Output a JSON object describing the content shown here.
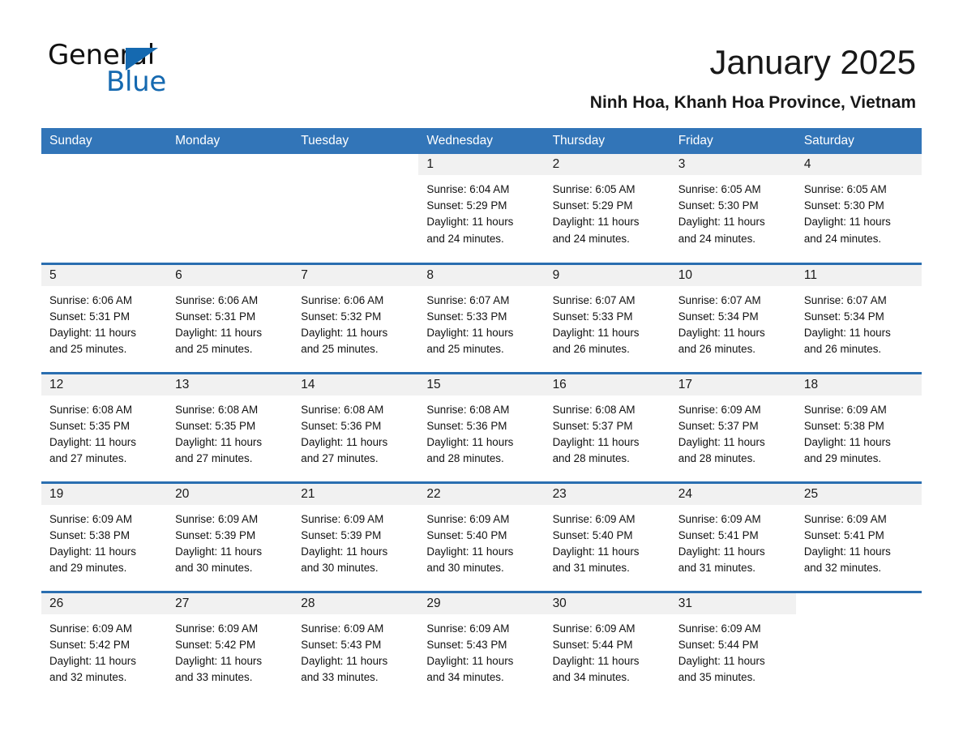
{
  "brand": {
    "name_part1": "General",
    "name_part2": "Blue",
    "accent_color": "#1569b0",
    "logo_icon": "triangle-flag-icon"
  },
  "header": {
    "title": "January 2025",
    "subtitle": "Ninh Hoa, Khanh Hoa Province, Vietnam"
  },
  "calendar": {
    "header_bg": "#3275b8",
    "header_text_color": "#ffffff",
    "row_separator_color": "#2a6eb0",
    "date_band_bg": "#f1f1f1",
    "weekdays": [
      "Sunday",
      "Monday",
      "Tuesday",
      "Wednesday",
      "Thursday",
      "Friday",
      "Saturday"
    ],
    "weeks": [
      [
        {
          "day": "",
          "sunrise": "",
          "sunset": "",
          "daylight_line1": "",
          "daylight_line2": "",
          "blank": true
        },
        {
          "day": "",
          "sunrise": "",
          "sunset": "",
          "daylight_line1": "",
          "daylight_line2": "",
          "blank": true
        },
        {
          "day": "",
          "sunrise": "",
          "sunset": "",
          "daylight_line1": "",
          "daylight_line2": "",
          "blank": true
        },
        {
          "day": "1",
          "sunrise": "Sunrise: 6:04 AM",
          "sunset": "Sunset: 5:29 PM",
          "daylight_line1": "Daylight: 11 hours",
          "daylight_line2": "and 24 minutes.",
          "blank": false
        },
        {
          "day": "2",
          "sunrise": "Sunrise: 6:05 AM",
          "sunset": "Sunset: 5:29 PM",
          "daylight_line1": "Daylight: 11 hours",
          "daylight_line2": "and 24 minutes.",
          "blank": false
        },
        {
          "day": "3",
          "sunrise": "Sunrise: 6:05 AM",
          "sunset": "Sunset: 5:30 PM",
          "daylight_line1": "Daylight: 11 hours",
          "daylight_line2": "and 24 minutes.",
          "blank": false
        },
        {
          "day": "4",
          "sunrise": "Sunrise: 6:05 AM",
          "sunset": "Sunset: 5:30 PM",
          "daylight_line1": "Daylight: 11 hours",
          "daylight_line2": "and 24 minutes.",
          "blank": false
        }
      ],
      [
        {
          "day": "5",
          "sunrise": "Sunrise: 6:06 AM",
          "sunset": "Sunset: 5:31 PM",
          "daylight_line1": "Daylight: 11 hours",
          "daylight_line2": "and 25 minutes.",
          "blank": false
        },
        {
          "day": "6",
          "sunrise": "Sunrise: 6:06 AM",
          "sunset": "Sunset: 5:31 PM",
          "daylight_line1": "Daylight: 11 hours",
          "daylight_line2": "and 25 minutes.",
          "blank": false
        },
        {
          "day": "7",
          "sunrise": "Sunrise: 6:06 AM",
          "sunset": "Sunset: 5:32 PM",
          "daylight_line1": "Daylight: 11 hours",
          "daylight_line2": "and 25 minutes.",
          "blank": false
        },
        {
          "day": "8",
          "sunrise": "Sunrise: 6:07 AM",
          "sunset": "Sunset: 5:33 PM",
          "daylight_line1": "Daylight: 11 hours",
          "daylight_line2": "and 25 minutes.",
          "blank": false
        },
        {
          "day": "9",
          "sunrise": "Sunrise: 6:07 AM",
          "sunset": "Sunset: 5:33 PM",
          "daylight_line1": "Daylight: 11 hours",
          "daylight_line2": "and 26 minutes.",
          "blank": false
        },
        {
          "day": "10",
          "sunrise": "Sunrise: 6:07 AM",
          "sunset": "Sunset: 5:34 PM",
          "daylight_line1": "Daylight: 11 hours",
          "daylight_line2": "and 26 minutes.",
          "blank": false
        },
        {
          "day": "11",
          "sunrise": "Sunrise: 6:07 AM",
          "sunset": "Sunset: 5:34 PM",
          "daylight_line1": "Daylight: 11 hours",
          "daylight_line2": "and 26 minutes.",
          "blank": false
        }
      ],
      [
        {
          "day": "12",
          "sunrise": "Sunrise: 6:08 AM",
          "sunset": "Sunset: 5:35 PM",
          "daylight_line1": "Daylight: 11 hours",
          "daylight_line2": "and 27 minutes.",
          "blank": false
        },
        {
          "day": "13",
          "sunrise": "Sunrise: 6:08 AM",
          "sunset": "Sunset: 5:35 PM",
          "daylight_line1": "Daylight: 11 hours",
          "daylight_line2": "and 27 minutes.",
          "blank": false
        },
        {
          "day": "14",
          "sunrise": "Sunrise: 6:08 AM",
          "sunset": "Sunset: 5:36 PM",
          "daylight_line1": "Daylight: 11 hours",
          "daylight_line2": "and 27 minutes.",
          "blank": false
        },
        {
          "day": "15",
          "sunrise": "Sunrise: 6:08 AM",
          "sunset": "Sunset: 5:36 PM",
          "daylight_line1": "Daylight: 11 hours",
          "daylight_line2": "and 28 minutes.",
          "blank": false
        },
        {
          "day": "16",
          "sunrise": "Sunrise: 6:08 AM",
          "sunset": "Sunset: 5:37 PM",
          "daylight_line1": "Daylight: 11 hours",
          "daylight_line2": "and 28 minutes.",
          "blank": false
        },
        {
          "day": "17",
          "sunrise": "Sunrise: 6:09 AM",
          "sunset": "Sunset: 5:37 PM",
          "daylight_line1": "Daylight: 11 hours",
          "daylight_line2": "and 28 minutes.",
          "blank": false
        },
        {
          "day": "18",
          "sunrise": "Sunrise: 6:09 AM",
          "sunset": "Sunset: 5:38 PM",
          "daylight_line1": "Daylight: 11 hours",
          "daylight_line2": "and 29 minutes.",
          "blank": false
        }
      ],
      [
        {
          "day": "19",
          "sunrise": "Sunrise: 6:09 AM",
          "sunset": "Sunset: 5:38 PM",
          "daylight_line1": "Daylight: 11 hours",
          "daylight_line2": "and 29 minutes.",
          "blank": false
        },
        {
          "day": "20",
          "sunrise": "Sunrise: 6:09 AM",
          "sunset": "Sunset: 5:39 PM",
          "daylight_line1": "Daylight: 11 hours",
          "daylight_line2": "and 30 minutes.",
          "blank": false
        },
        {
          "day": "21",
          "sunrise": "Sunrise: 6:09 AM",
          "sunset": "Sunset: 5:39 PM",
          "daylight_line1": "Daylight: 11 hours",
          "daylight_line2": "and 30 minutes.",
          "blank": false
        },
        {
          "day": "22",
          "sunrise": "Sunrise: 6:09 AM",
          "sunset": "Sunset: 5:40 PM",
          "daylight_line1": "Daylight: 11 hours",
          "daylight_line2": "and 30 minutes.",
          "blank": false
        },
        {
          "day": "23",
          "sunrise": "Sunrise: 6:09 AM",
          "sunset": "Sunset: 5:40 PM",
          "daylight_line1": "Daylight: 11 hours",
          "daylight_line2": "and 31 minutes.",
          "blank": false
        },
        {
          "day": "24",
          "sunrise": "Sunrise: 6:09 AM",
          "sunset": "Sunset: 5:41 PM",
          "daylight_line1": "Daylight: 11 hours",
          "daylight_line2": "and 31 minutes.",
          "blank": false
        },
        {
          "day": "25",
          "sunrise": "Sunrise: 6:09 AM",
          "sunset": "Sunset: 5:41 PM",
          "daylight_line1": "Daylight: 11 hours",
          "daylight_line2": "and 32 minutes.",
          "blank": false
        }
      ],
      [
        {
          "day": "26",
          "sunrise": "Sunrise: 6:09 AM",
          "sunset": "Sunset: 5:42 PM",
          "daylight_line1": "Daylight: 11 hours",
          "daylight_line2": "and 32 minutes.",
          "blank": false
        },
        {
          "day": "27",
          "sunrise": "Sunrise: 6:09 AM",
          "sunset": "Sunset: 5:42 PM",
          "daylight_line1": "Daylight: 11 hours",
          "daylight_line2": "and 33 minutes.",
          "blank": false
        },
        {
          "day": "28",
          "sunrise": "Sunrise: 6:09 AM",
          "sunset": "Sunset: 5:43 PM",
          "daylight_line1": "Daylight: 11 hours",
          "daylight_line2": "and 33 minutes.",
          "blank": false
        },
        {
          "day": "29",
          "sunrise": "Sunrise: 6:09 AM",
          "sunset": "Sunset: 5:43 PM",
          "daylight_line1": "Daylight: 11 hours",
          "daylight_line2": "and 34 minutes.",
          "blank": false
        },
        {
          "day": "30",
          "sunrise": "Sunrise: 6:09 AM",
          "sunset": "Sunset: 5:44 PM",
          "daylight_line1": "Daylight: 11 hours",
          "daylight_line2": "and 34 minutes.",
          "blank": false
        },
        {
          "day": "31",
          "sunrise": "Sunrise: 6:09 AM",
          "sunset": "Sunset: 5:44 PM",
          "daylight_line1": "Daylight: 11 hours",
          "daylight_line2": "and 35 minutes.",
          "blank": false
        },
        {
          "day": "",
          "sunrise": "",
          "sunset": "",
          "daylight_line1": "",
          "daylight_line2": "",
          "blank": true
        }
      ]
    ]
  }
}
